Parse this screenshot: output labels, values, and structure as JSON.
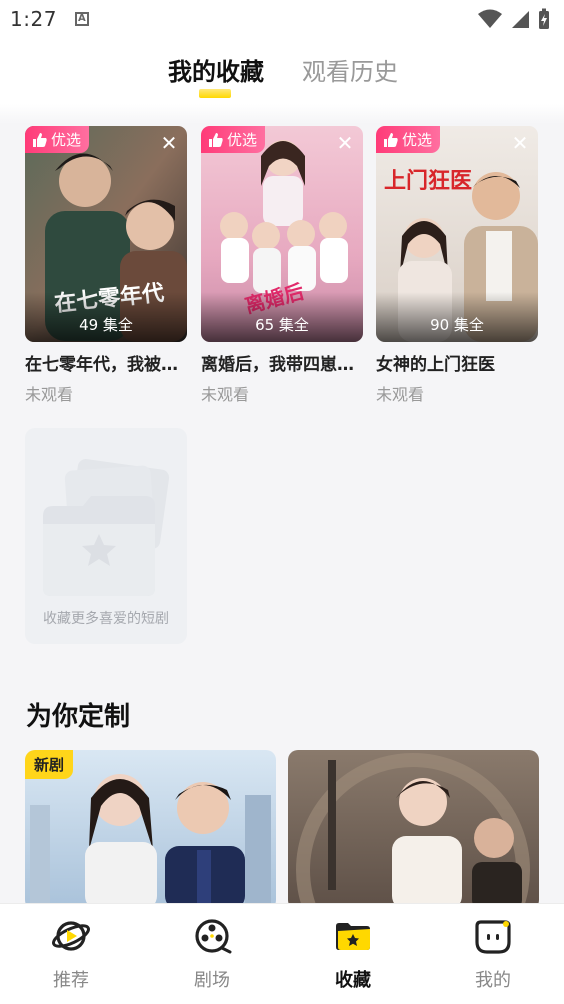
{
  "status_bar": {
    "time": "1:27",
    "a_icon": "A"
  },
  "header": {
    "tabs": [
      {
        "label": "我的收藏",
        "active": true
      },
      {
        "label": "观看历史",
        "active": false
      }
    ]
  },
  "favorites": [
    {
      "badge": "优选",
      "episodes": "49 集全",
      "title": "在七零年代，我被…",
      "status": "未观看"
    },
    {
      "badge": "优选",
      "episodes": "65 集全",
      "title": "离婚后，我带四崽…",
      "status": "未观看"
    },
    {
      "badge": "优选",
      "episodes": "90 集全",
      "title": "女神的上门狂医",
      "status": "未观看"
    }
  ],
  "empty_card": {
    "text": "收藏更多喜爱的短剧"
  },
  "recommend": {
    "title": "为你定制",
    "cards": [
      {
        "badge": "新剧"
      },
      {
        "badge": ""
      }
    ]
  },
  "bottom_nav": [
    {
      "label": "推荐",
      "icon": "planet-icon",
      "active": false
    },
    {
      "label": "剧场",
      "icon": "film-reel-icon",
      "active": false
    },
    {
      "label": "收藏",
      "icon": "folder-star-icon",
      "active": true
    },
    {
      "label": "我的",
      "icon": "face-icon",
      "active": false
    }
  ],
  "colors": {
    "accent": "#ffd800",
    "badge_pink": "#ff3b78",
    "muted": "#999999"
  }
}
